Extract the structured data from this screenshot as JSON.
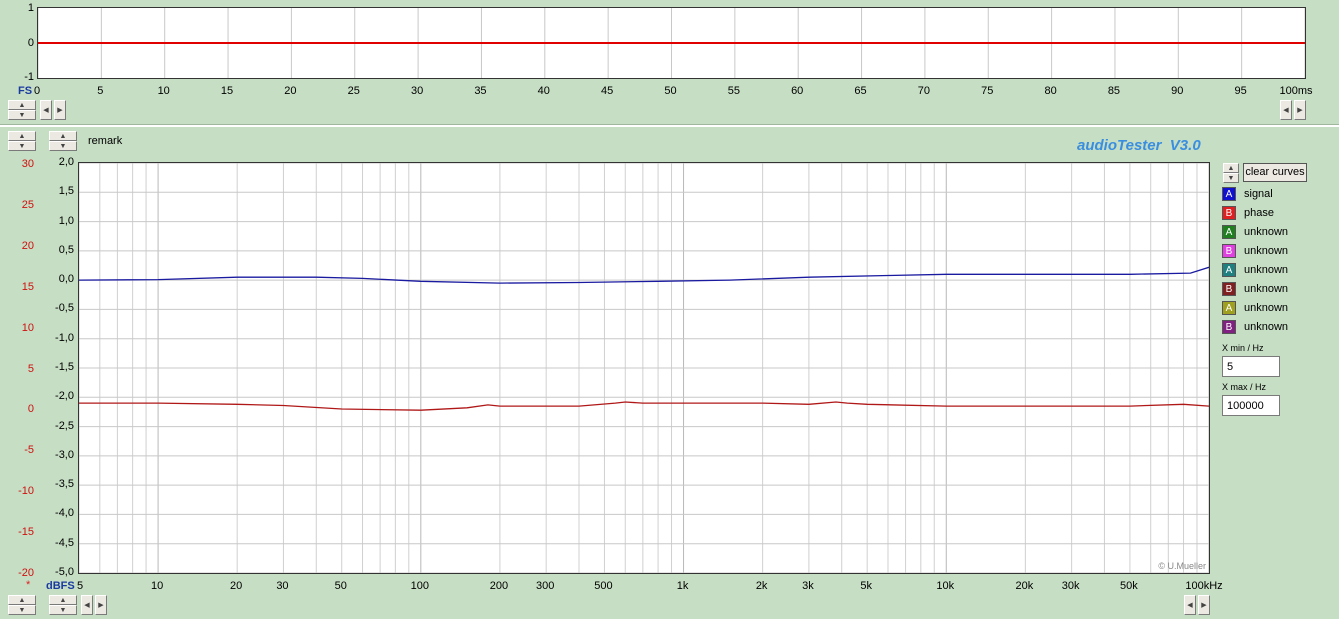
{
  "top_scope": {
    "y_labels": [
      "1",
      "0",
      "-1"
    ],
    "x_unit_prefix": "FS",
    "x_labels": [
      "0",
      "5",
      "10",
      "15",
      "20",
      "25",
      "30",
      "35",
      "40",
      "45",
      "50",
      "55",
      "60",
      "65",
      "70",
      "75",
      "80",
      "85",
      "90",
      "95",
      "100ms"
    ]
  },
  "main": {
    "remark": "remark",
    "brand": "audioTester  V3.0",
    "watermark": "© U.Mueller",
    "clear_button": "clear curves",
    "left_axis_labels": [
      "30",
      "25",
      "20",
      "15",
      "10",
      "5",
      "0",
      "-5",
      "-10",
      "-15",
      "-20"
    ],
    "right_axis_labels": [
      "2,0",
      "1,5",
      "1,0",
      "0,5",
      "0,0",
      "-0,5",
      "-1,0",
      "-1,5",
      "-2,0",
      "-2,5",
      "-3,0",
      "-3,5",
      "-4,0",
      "-4,5",
      "-5,0"
    ],
    "left_axis_marker": "*",
    "y_unit": "dBFS",
    "x_labels": [
      "5",
      "10",
      "20",
      "30",
      "50",
      "100",
      "200",
      "300",
      "500",
      "1k",
      "2k",
      "3k",
      "5k",
      "10k",
      "20k",
      "30k",
      "50k",
      "100kHz"
    ],
    "xmin_label": "X min / Hz",
    "xmin_value": "5",
    "xmax_label": "X max / Hz",
    "xmax_value": "100000",
    "legend": [
      {
        "letter": "A",
        "label": "signal",
        "color": "#1010d0"
      },
      {
        "letter": "B",
        "label": "phase",
        "color": "#e02020"
      },
      {
        "letter": "A",
        "label": "unknown",
        "color": "#208020"
      },
      {
        "letter": "B",
        "label": "unknown",
        "color": "#e040e0"
      },
      {
        "letter": "A",
        "label": "unknown",
        "color": "#208080"
      },
      {
        "letter": "B",
        "label": "unknown",
        "color": "#802020"
      },
      {
        "letter": "A",
        "label": "unknown",
        "color": "#a0a020"
      },
      {
        "letter": "B",
        "label": "unknown",
        "color": "#802080"
      }
    ]
  },
  "chart_data": [
    {
      "type": "line",
      "title": "",
      "x_unit": "ms",
      "xlim": [
        0,
        100
      ],
      "ylim": [
        -1,
        1
      ],
      "grid": true,
      "series": [
        {
          "x": [
            0,
            100
          ],
          "values": [
            0,
            0
          ],
          "color": "#e00000"
        }
      ]
    },
    {
      "type": "line",
      "x_scale": "log",
      "x_unit": "Hz",
      "xlim": [
        5,
        100000
      ],
      "ylim": [
        -5.0,
        2.0
      ],
      "grid": true,
      "series": [
        {
          "name": "signal",
          "color": "#1a1aa0",
          "x": [
            5,
            10,
            20,
            40,
            60,
            100,
            200,
            400,
            800,
            1500,
            3000,
            6000,
            10000,
            20000,
            50000,
            85000,
            100000
          ],
          "values": [
            0.0,
            0.01,
            0.05,
            0.05,
            0.03,
            -0.02,
            -0.05,
            -0.04,
            -0.02,
            0.0,
            0.05,
            0.08,
            0.1,
            0.1,
            0.1,
            0.12,
            0.22
          ]
        },
        {
          "name": "phase",
          "color": "#b01818",
          "x": [
            5,
            10,
            20,
            30,
            50,
            100,
            150,
            180,
            200,
            400,
            550,
            600,
            700,
            1000,
            2000,
            3000,
            3800,
            4200,
            5000,
            10000,
            20000,
            50000,
            80000,
            100000
          ],
          "values": [
            -2.1,
            -2.1,
            -2.12,
            -2.14,
            -2.2,
            -2.22,
            -2.18,
            -2.13,
            -2.15,
            -2.15,
            -2.1,
            -2.08,
            -2.1,
            -2.1,
            -2.1,
            -2.12,
            -2.08,
            -2.1,
            -2.12,
            -2.15,
            -2.15,
            -2.15,
            -2.12,
            -2.15
          ]
        }
      ]
    }
  ]
}
